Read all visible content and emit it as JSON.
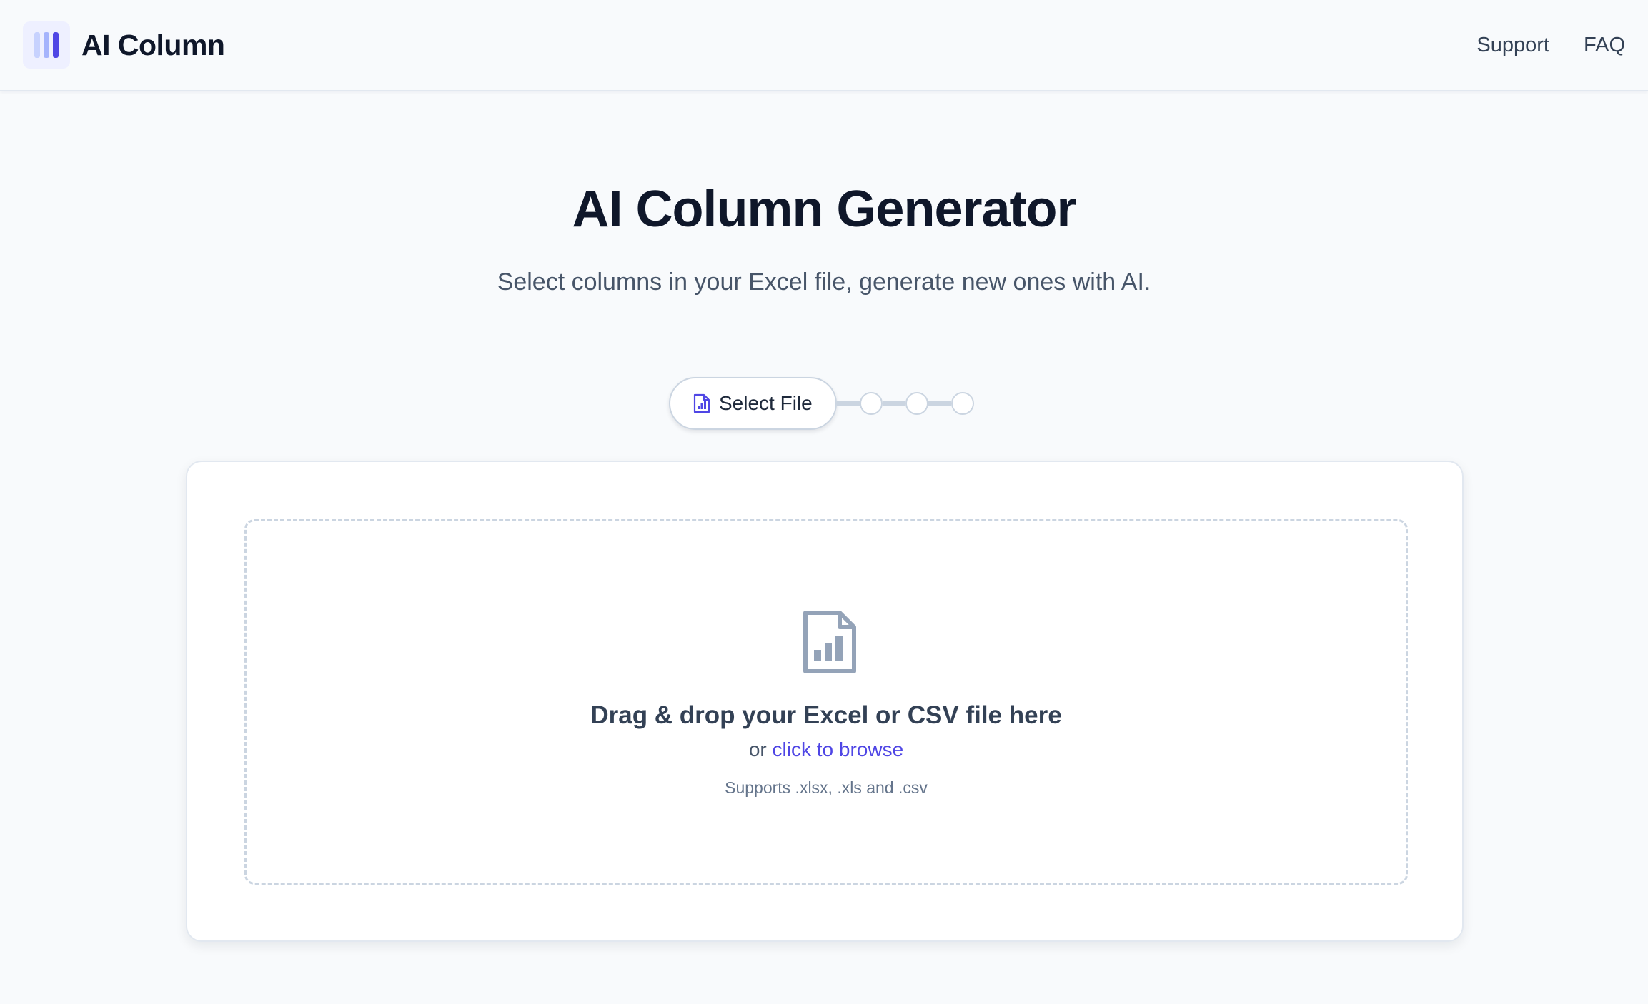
{
  "header": {
    "brand_name": "AI Column",
    "logo_icon": "columns-icon",
    "nav": [
      {
        "label": "Support"
      },
      {
        "label": "FAQ"
      }
    ]
  },
  "hero": {
    "title": "AI Column Generator",
    "subtitle": "Select columns in your Excel file, generate new ones with AI."
  },
  "stepper": {
    "current_step_label": "Select File",
    "current_step_icon": "spreadsheet-file-icon",
    "total_steps": 4,
    "active_step": 1
  },
  "upload": {
    "icon": "spreadsheet-file-icon",
    "title": "Drag & drop your Excel or CSV file here",
    "or_text": "or",
    "browse_text": "click to browse",
    "supports_text": "Supports .xlsx, .xls and .csv"
  },
  "colors": {
    "accent": "#4f46e5",
    "accent_soft": "#a5b4fc",
    "background": "#f8fafc",
    "muted_icon": "#94a3b8"
  }
}
